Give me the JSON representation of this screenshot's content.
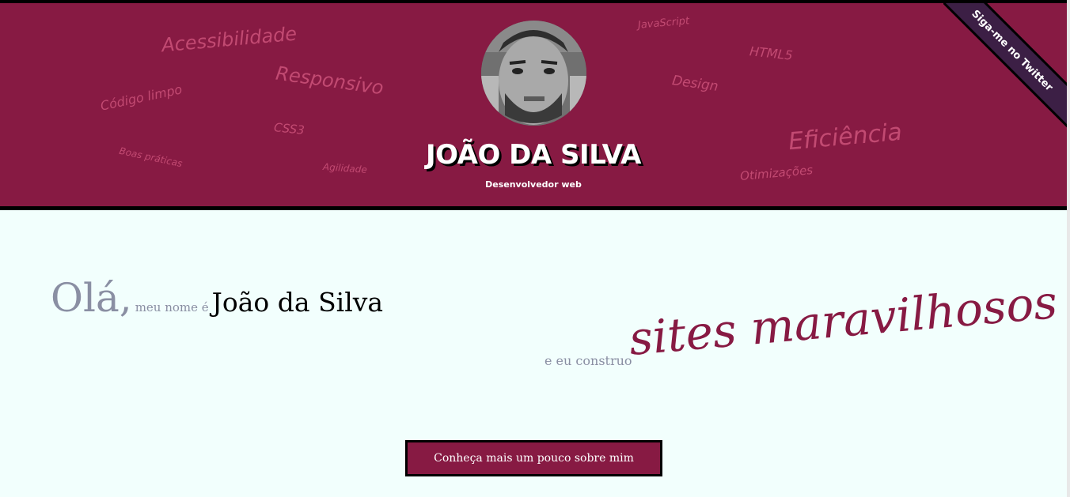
{
  "header": {
    "name": "JOÃO DA SILVA",
    "role": "Desenvolvedor web",
    "ribbon": "Siga-me no Twitter",
    "tags": [
      "Acessibilidade",
      "Responsivo",
      "Código limpo",
      "CSS3",
      "Boas práticas",
      "Agilidade",
      "JavaScript",
      "HTML5",
      "Design",
      "Eficiência",
      "Otimizações"
    ]
  },
  "intro": {
    "ola": "Olá,",
    "meu_nome": "meu nome é",
    "name": "João da Silva",
    "eu_construo": "e eu construo",
    "sites": "sites maravilhosos"
  },
  "cta": {
    "label": "Conheça mais um pouco sobre mim"
  },
  "colors": {
    "primary": "#871a43",
    "background": "#f2fffd",
    "ribbon": "#3c1f45"
  }
}
